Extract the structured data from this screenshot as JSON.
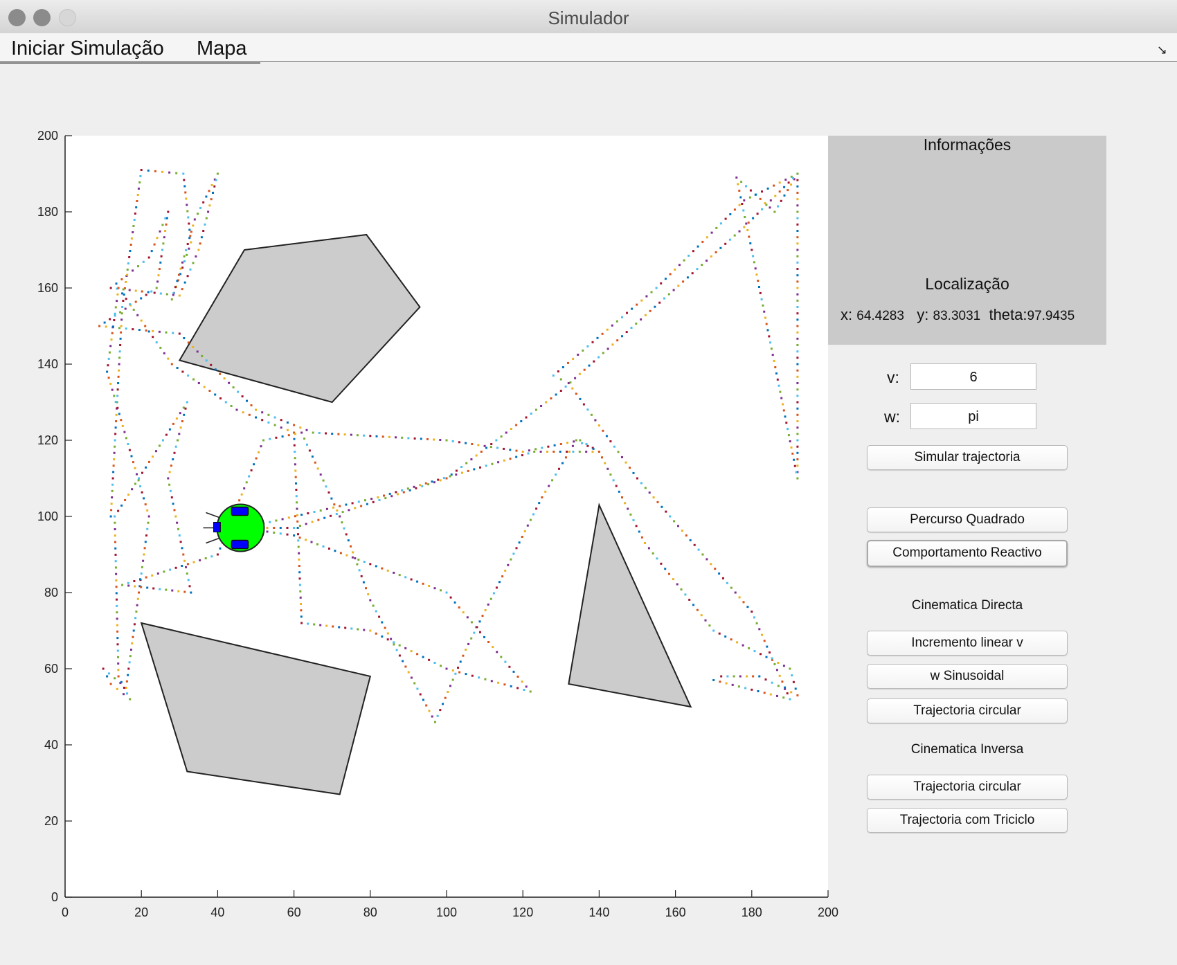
{
  "window": {
    "title": "Simulador"
  },
  "menu": {
    "items": [
      "Iniciar Simulação",
      "Mapa"
    ]
  },
  "info_panel": {
    "title": "Informações",
    "localization_title": "Localização",
    "x_label": "x:",
    "x_value": "64.4283",
    "y_label": "y:",
    "y_value": "83.3031",
    "theta_label": "theta:",
    "theta_value": "97.9435"
  },
  "inputs": {
    "v_label": "v:",
    "v_value": "6",
    "w_label": "w:",
    "w_value": "pi"
  },
  "buttons": {
    "simulate": "Simular trajectoria",
    "square": "Percurso Quadrado",
    "reactive": "Comportamento Reactivo",
    "linear": "Incremento linear v",
    "sinusoidal": "w Sinusoidal",
    "circular_direct": "Trajectoria circular",
    "circular_inverse": "Trajectoria circular",
    "tricycle": "Trajectoria com Triciclo"
  },
  "sections": {
    "direct": "Cinematica Directa",
    "inverse": "Cinematica Inversa"
  },
  "chart_data": {
    "type": "scatter",
    "title": "",
    "xlabel": "",
    "ylabel": "",
    "xlim": [
      0,
      200
    ],
    "ylim": [
      0,
      200
    ],
    "xticks": [
      0,
      20,
      40,
      60,
      80,
      100,
      120,
      140,
      160,
      180,
      200
    ],
    "yticks": [
      0,
      20,
      40,
      60,
      80,
      100,
      120,
      140,
      160,
      180,
      200
    ],
    "grid": false,
    "obstacles": [
      {
        "shape": "pentagon",
        "vertices": [
          [
            47,
            170
          ],
          [
            79,
            174
          ],
          [
            93,
            155
          ],
          [
            70,
            130
          ],
          [
            30,
            141
          ]
        ]
      },
      {
        "shape": "quadrilateral",
        "vertices": [
          [
            20,
            72
          ],
          [
            80,
            58
          ],
          [
            72,
            27
          ],
          [
            32,
            33
          ]
        ]
      },
      {
        "shape": "triangle",
        "vertices": [
          [
            140,
            103
          ],
          [
            164,
            50
          ],
          [
            132,
            56
          ]
        ]
      }
    ],
    "robot": {
      "x": 46,
      "y": 97,
      "color": "#00ff00"
    },
    "trajectory_colors": [
      "#0072bd",
      "#d95319",
      "#edb120",
      "#7e2f8e",
      "#77ac30",
      "#4dbeee",
      "#a2142f"
    ],
    "trajectory": [
      [
        12,
        100
      ],
      [
        15,
        155
      ],
      [
        20,
        191
      ],
      [
        31,
        190
      ],
      [
        33,
        172
      ],
      [
        28,
        157
      ],
      [
        34,
        178
      ],
      [
        40,
        190
      ],
      [
        35,
        170
      ],
      [
        30,
        158
      ],
      [
        12,
        160
      ],
      [
        22,
        168
      ],
      [
        27,
        180
      ],
      [
        24,
        160
      ],
      [
        9,
        150
      ],
      [
        30,
        148
      ],
      [
        50,
        128
      ],
      [
        65,
        122
      ],
      [
        100,
        120
      ],
      [
        120,
        117
      ],
      [
        135,
        120
      ],
      [
        140,
        117
      ],
      [
        152,
        93
      ],
      [
        170,
        70
      ],
      [
        190,
        60
      ],
      [
        192,
        53
      ],
      [
        182,
        58
      ],
      [
        172,
        58
      ],
      [
        170,
        57
      ],
      [
        190,
        52
      ],
      [
        180,
        75
      ],
      [
        150,
        110
      ],
      [
        132,
        135
      ],
      [
        128,
        137
      ],
      [
        155,
        160
      ],
      [
        178,
        183
      ],
      [
        192,
        190
      ],
      [
        192,
        110
      ],
      [
        180,
        170
      ],
      [
        176,
        189
      ],
      [
        186,
        180
      ],
      [
        192,
        190
      ],
      [
        178,
        176
      ],
      [
        130,
        133
      ],
      [
        100,
        110
      ],
      [
        60,
        97
      ],
      [
        46,
        97
      ],
      [
        60,
        95
      ],
      [
        100,
        80
      ],
      [
        122,
        54
      ],
      [
        100,
        60
      ],
      [
        80,
        70
      ],
      [
        62,
        72
      ],
      [
        60,
        122
      ],
      [
        45,
        128
      ],
      [
        28,
        140
      ],
      [
        14,
        160
      ],
      [
        11,
        138
      ],
      [
        22,
        100
      ],
      [
        16,
        55
      ],
      [
        10,
        60
      ],
      [
        12,
        56
      ],
      [
        17,
        52
      ],
      [
        14,
        58
      ],
      [
        13,
        100
      ],
      [
        32,
        130
      ],
      [
        27,
        110
      ],
      [
        33,
        80
      ],
      [
        15,
        82
      ],
      [
        40,
        90
      ],
      [
        52,
        120
      ],
      [
        62,
        122
      ],
      [
        72,
        100
      ],
      [
        80,
        78
      ],
      [
        97,
        46
      ],
      [
        105,
        65
      ],
      [
        125,
        105
      ],
      [
        134,
        120
      ],
      [
        140,
        117
      ],
      [
        123,
        117
      ],
      [
        82,
        105
      ],
      [
        47,
        97
      ]
    ]
  }
}
